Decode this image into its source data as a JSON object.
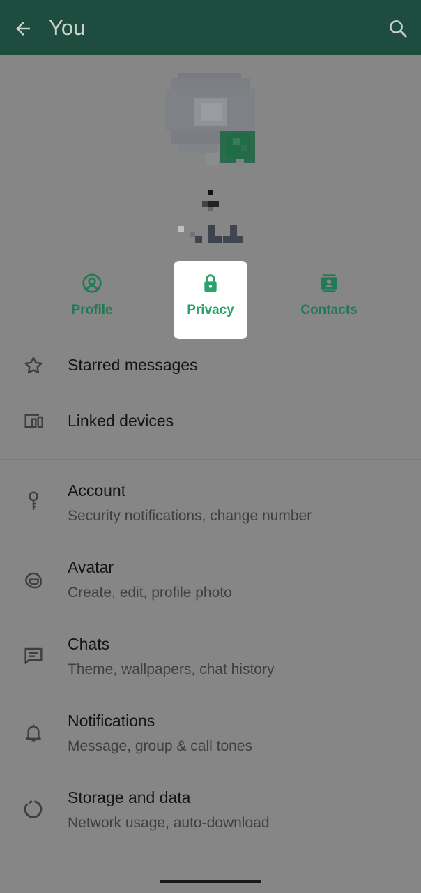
{
  "header": {
    "title": "You",
    "back_icon": "arrow-left-icon",
    "search_icon": "search-icon"
  },
  "tabs": [
    {
      "label": "Profile",
      "icon": "account-circle-icon"
    },
    {
      "label": "Privacy",
      "icon": "lock-icon",
      "selected": true
    },
    {
      "label": "Contacts",
      "icon": "contacts-icon"
    }
  ],
  "quick_items": [
    {
      "label": "Starred messages",
      "icon": "star-icon"
    },
    {
      "label": "Linked devices",
      "icon": "devices-icon"
    }
  ],
  "settings": [
    {
      "label": "Account",
      "sub": "Security notifications, change number",
      "icon": "key-icon"
    },
    {
      "label": "Avatar",
      "sub": "Create, edit, profile photo",
      "icon": "avatar-face-icon"
    },
    {
      "label": "Chats",
      "sub": "Theme, wallpapers, chat history",
      "icon": "chat-icon"
    },
    {
      "label": "Notifications",
      "sub": "Message, group & call tones",
      "icon": "bell-icon"
    },
    {
      "label": "Storage and data",
      "sub": "Network usage, auto-download",
      "icon": "storage-ring-icon"
    }
  ],
  "colors": {
    "appbar": "#1e4c3f",
    "accent": "#29a36a",
    "scrim": "#868686"
  }
}
